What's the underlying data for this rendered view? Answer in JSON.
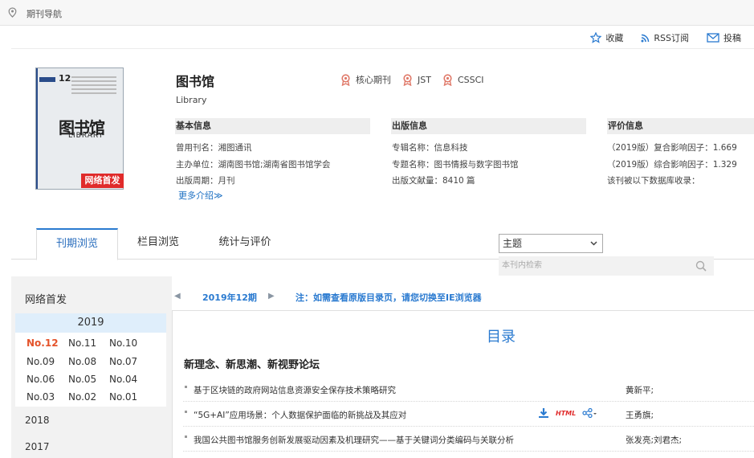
{
  "topbar": {
    "breadcrumb": "期刊导航"
  },
  "actions": {
    "favorite": "收藏",
    "rss": "RSS订阅",
    "submit": "投稿"
  },
  "cover": {
    "issue_number": "12",
    "logo_text": "图书馆",
    "logo_sub": "LIBRARY",
    "badge": "网络首发"
  },
  "journal": {
    "title": "图书馆",
    "english_title": "Library",
    "tags": [
      "核心期刊",
      "JST",
      "CSSCI"
    ]
  },
  "basic_info": {
    "header": "基本信息",
    "former_name_label": "曾用刊名：",
    "former_name": "湘图通讯",
    "sponsor_label": "主办单位：",
    "sponsor": "湖南图书馆;湖南省图书馆学会",
    "period_label": "出版周期：",
    "period": "月刊",
    "more": "更多介绍≫"
  },
  "publish_info": {
    "header": "出版信息",
    "series_label": "专辑名称：",
    "series": "信息科技",
    "topic_label": "专题名称：",
    "topic": "图书情报与数字图书馆",
    "count_label": "出版文献量：",
    "count": "8410 篇"
  },
  "eval_info": {
    "header": "评价信息",
    "composite": "（2019版）复合影响因子：1.669",
    "comprehensive": "（2019版）综合影响因子：1.329",
    "db_note": "该刊被以下数据库收录："
  },
  "tabs": [
    "刊期浏览",
    "栏目浏览",
    "统计与评价"
  ],
  "search": {
    "select": "主题",
    "placeholder": "本刊内检索"
  },
  "sidebar": {
    "header": "网络首发",
    "current_year": "2019",
    "issues": [
      "No.12",
      "No.11",
      "No.10",
      "No.09",
      "No.08",
      "No.07",
      "No.06",
      "No.05",
      "No.04",
      "No.03",
      "No.02",
      "No.01"
    ],
    "other_years": [
      "2018",
      "2017"
    ]
  },
  "main": {
    "issue_label": "2019年12期",
    "note": "注：如需查看原版目录页，请您切换至IE浏览器",
    "toc_title": "目录",
    "section": "新理念、新思潮、新视野论坛",
    "html_label": "HTML",
    "articles": [
      {
        "title": "基于区块链的政府网站信息资源安全保存技术策略研究",
        "authors": "黄新平;"
      },
      {
        "title": "“5G+AI”应用场景：个人数据保护面临的新挑战及其应对",
        "authors": "王勇旗;"
      },
      {
        "title": "我国公共图书馆服务创新发展驱动因素及机理研究——基于关键词分类编码与关联分析",
        "authors": "张发亮;刘君杰;"
      }
    ]
  }
}
